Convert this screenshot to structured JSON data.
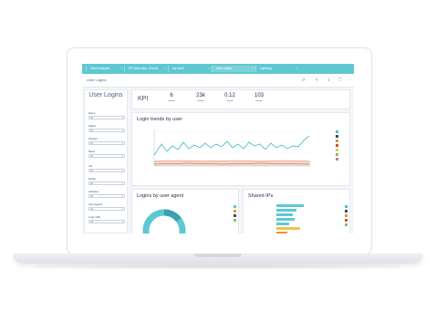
{
  "tabs": [
    {
      "label": "Wave Analytics"
    },
    {
      "label": "ER Wave app - Events"
    },
    {
      "label": "My Dash"
    },
    {
      "label": "User Logins"
    },
    {
      "label": "Lightning"
    }
  ],
  "toolbar": {
    "title": "User Logins"
  },
  "sidebar": {
    "title": "User Logins",
    "filters": [
      {
        "label": "Name",
        "value": "All"
      },
      {
        "label": "Status",
        "value": "All"
      },
      {
        "label": "Product",
        "value": "All"
      },
      {
        "label": "Roles",
        "value": "All"
      },
      {
        "label": "Via",
        "value": "All"
      },
      {
        "label": "Profile",
        "value": "All"
      },
      {
        "label": "Activities",
        "value": "All"
      },
      {
        "label": "User Agents",
        "value": "All"
      },
      {
        "label": "Login URL",
        "value": "All"
      }
    ]
  },
  "kpi": {
    "title": "KPI",
    "items": [
      {
        "value": "6"
      },
      {
        "value": "23k"
      },
      {
        "value": "0.12"
      },
      {
        "value": "103"
      }
    ]
  },
  "trends": {
    "title": "Login trends by user",
    "legend": [
      {
        "color": "#4fc0cc"
      },
      {
        "color": "#2f4b7c"
      },
      {
        "color": "#e7962e"
      },
      {
        "color": "#d04e42"
      },
      {
        "color": "#f2c14e"
      },
      {
        "color": "#7ac36a"
      },
      {
        "color": "#c874b0"
      }
    ]
  },
  "agent": {
    "title": "Logins by user agent"
  },
  "shared": {
    "title": "Shared IPs"
  },
  "colors": {
    "accent": "#5ec8d2",
    "header_text": "#54698d"
  }
}
